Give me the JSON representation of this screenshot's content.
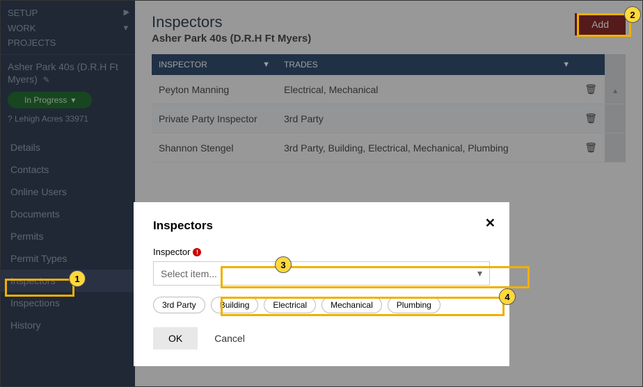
{
  "sidebar": {
    "sections": [
      {
        "label": "SETUP"
      },
      {
        "label": "WORK"
      },
      {
        "label": "PROJECTS"
      }
    ],
    "project_name": "Asher Park 40s (D.R.H Ft Myers)",
    "status": "In Progress",
    "address": "? Lehigh Acres 33971",
    "nav": [
      {
        "label": "Details"
      },
      {
        "label": "Contacts"
      },
      {
        "label": "Online Users"
      },
      {
        "label": "Documents"
      },
      {
        "label": "Permits"
      },
      {
        "label": "Permit Types"
      },
      {
        "label": "Inspectors"
      },
      {
        "label": "Inspections"
      },
      {
        "label": "History"
      }
    ]
  },
  "main": {
    "title": "Inspectors",
    "subtitle": "Asher Park 40s (D.R.H Ft Myers)",
    "add_label": "Add",
    "columns": {
      "inspector": "INSPECTOR",
      "trades": "TRADES"
    },
    "rows": [
      {
        "inspector": "Peyton Manning",
        "trades": "Electrical, Mechanical"
      },
      {
        "inspector": "Private Party Inspector",
        "trades": "3rd Party"
      },
      {
        "inspector": "Shannon Stengel",
        "trades": "3rd Party, Building, Electrical, Mechanical, Plumbing"
      }
    ]
  },
  "modal": {
    "title": "Inspectors",
    "field_label": "Inspector",
    "dropdown_placeholder": "Select item...",
    "chips": [
      "3rd Party",
      "Building",
      "Electrical",
      "Mechanical",
      "Plumbing"
    ],
    "ok": "OK",
    "cancel": "Cancel"
  },
  "annotations": {
    "a1": "1",
    "a2": "2",
    "a3": "3",
    "a4": "4"
  }
}
